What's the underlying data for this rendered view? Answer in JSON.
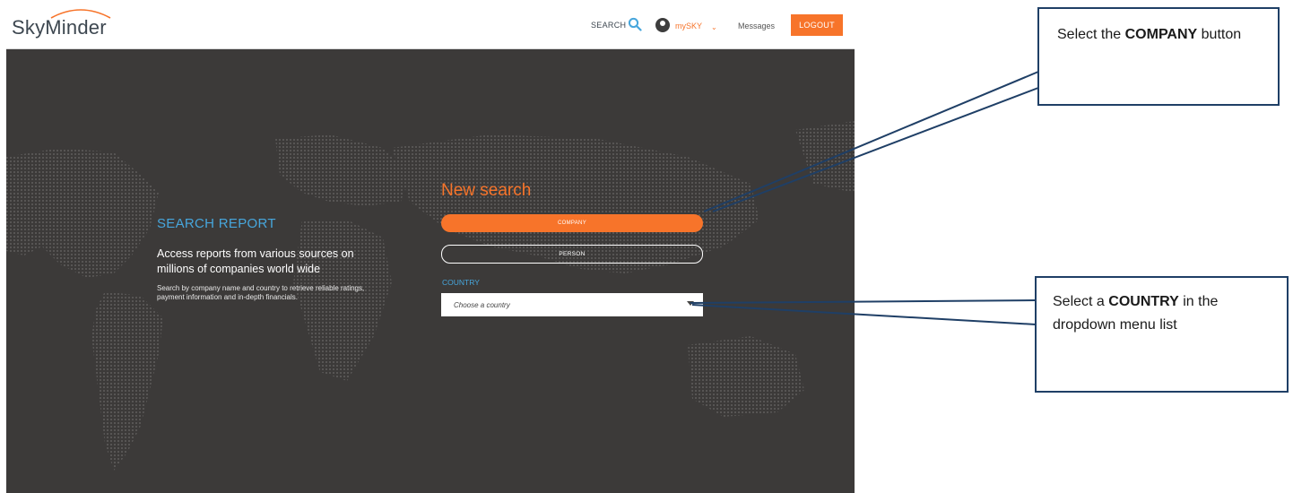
{
  "header": {
    "logo_text": "SkyMinder",
    "search_label": "SEARCH",
    "mysky_label": "mySKY",
    "messages_label": "Messages",
    "logout_label": "LOGOUT"
  },
  "hero": {
    "report_title": "SEARCH REPORT",
    "report_headline": "Access reports from various sources on millions of companies world wide",
    "report_description": "Search by company name and country to retrieve reliable ratings, payment information and in-depth financials."
  },
  "search_form": {
    "title": "New search",
    "company_button": "COMPANY",
    "person_button": "PERSON",
    "country_label": "COUNTRY",
    "country_placeholder": "Choose a country"
  },
  "callouts": {
    "company": {
      "prefix": "Select the ",
      "emphasis": "COMPANY",
      "suffix": " button"
    },
    "country": {
      "prefix": "Select a ",
      "emphasis": "COUNTRY",
      "suffix": " in the dropdown menu list"
    }
  },
  "colors": {
    "accent": "#f7742a",
    "link_blue": "#47a6dc",
    "hero_bg": "#3c3a39",
    "callout_border": "#1f3f66"
  },
  "icons": [
    "search-icon",
    "user-icon",
    "chevron-down-icon",
    "dropdown-arrow-icon",
    "world-map-icon"
  ]
}
